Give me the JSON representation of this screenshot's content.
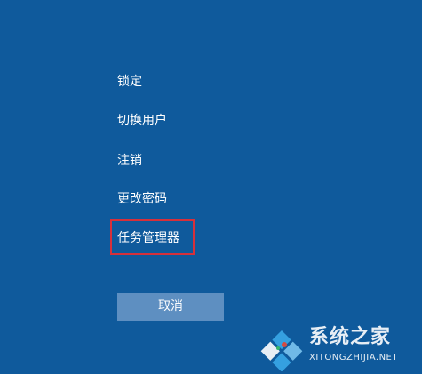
{
  "menu": {
    "items": [
      {
        "label": "锁定"
      },
      {
        "label": "切换用户"
      },
      {
        "label": "注销"
      },
      {
        "label": "更改密码"
      },
      {
        "label": "任务管理器",
        "highlighted": true
      }
    ]
  },
  "cancel_button": {
    "label": "取消"
  },
  "watermark": {
    "title": "系统之家",
    "url": "XITONGZHIJIA.NET"
  },
  "colors": {
    "background": "#0f5a9c",
    "button": "#5e8fc1",
    "highlight": "#d7303b",
    "text": "#ffffff"
  }
}
